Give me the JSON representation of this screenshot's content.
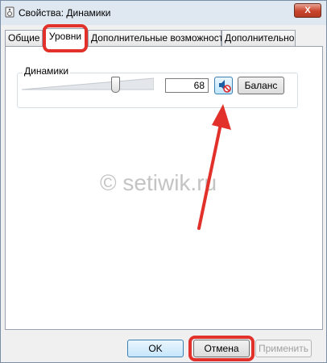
{
  "window": {
    "title": "Свойства: Динамики",
    "close_label": "X"
  },
  "tabs": [
    {
      "label": "Общие"
    },
    {
      "label": "Уровни",
      "active": true
    },
    {
      "label": "Дополнительные возможности"
    },
    {
      "label": "Дополнительно"
    }
  ],
  "levels": {
    "group_label": "Динамики",
    "volume": 68,
    "volume_text": "68",
    "muted": true,
    "balance_label": "Баланс"
  },
  "watermark": "© setiwik.ru",
  "buttons": {
    "ok": "OK",
    "cancel": "Отмена",
    "apply": "Применить"
  },
  "colors": {
    "highlight": "#e2302a",
    "mute_icon_blue": "#1d5fa5",
    "mute_badge_red": "#d8262b"
  },
  "icons": {
    "title": "speaker-properties-icon",
    "mute": "speaker-muted-icon"
  }
}
